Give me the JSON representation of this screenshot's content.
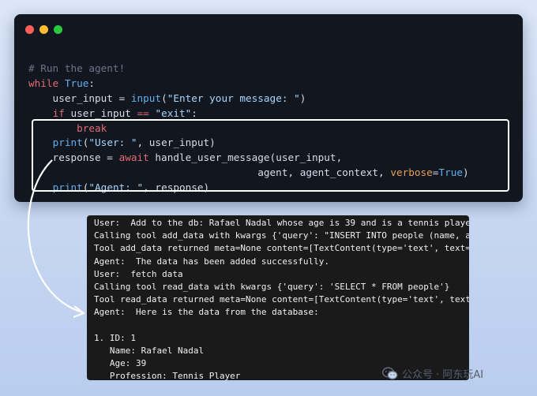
{
  "window_controls": {
    "close_color": "#ff5f57",
    "minimize_color": "#febc2e",
    "maximize_color": "#28c840"
  },
  "syntax_colors": {
    "comment": "#6b7486",
    "keyword": "#e06c75",
    "builtin": "#61afef",
    "string": "#a5d6ff",
    "param": "#e5a25b",
    "text": "#d6dde8"
  },
  "code_lines": [
    [
      {
        "t": "# Run the agent!",
        "c": "comment"
      }
    ],
    [
      {
        "t": "while",
        "c": "keyword"
      },
      {
        "t": " "
      },
      {
        "t": "True",
        "c": "builtin"
      },
      {
        "t": ":"
      }
    ],
    [
      {
        "t": "    user_input = "
      },
      {
        "t": "input",
        "c": "builtin"
      },
      {
        "t": "("
      },
      {
        "t": "\"Enter your message: \"",
        "c": "string"
      },
      {
        "t": ")"
      }
    ],
    [
      {
        "t": "    "
      },
      {
        "t": "if",
        "c": "keyword"
      },
      {
        "t": " user_input "
      },
      {
        "t": "==",
        "c": "keyword"
      },
      {
        "t": " "
      },
      {
        "t": "\"exit\"",
        "c": "string"
      },
      {
        "t": ":"
      }
    ],
    [
      {
        "t": "        "
      },
      {
        "t": "break",
        "c": "keyword"
      }
    ],
    [
      {
        "t": "    "
      },
      {
        "t": "print",
        "c": "builtin"
      },
      {
        "t": "("
      },
      {
        "t": "\"User: \"",
        "c": "string"
      },
      {
        "t": ", user_input)"
      }
    ],
    [
      {
        "t": "    response = "
      },
      {
        "t": "await",
        "c": "keyword"
      },
      {
        "t": " handle_user_message(user_input,"
      }
    ],
    [
      {
        "t": "                                      agent, agent_context, "
      },
      {
        "t": "verbose",
        "c": "param"
      },
      {
        "t": "="
      },
      {
        "t": "True",
        "c": "builtin"
      },
      {
        "t": ")"
      }
    ],
    [
      {
        "t": "    "
      },
      {
        "t": "print",
        "c": "builtin"
      },
      {
        "t": "("
      },
      {
        "t": "\"Agent: \"",
        "c": "string"
      },
      {
        "t": ", response)"
      }
    ]
  ],
  "terminal_lines": [
    "User:  Add to the db: Rafael Nadal whose age is 39 and is a tennis player",
    "Calling tool add_data with kwargs {'query': \"INSERT INTO people (name, age",
    "Tool add_data returned meta=None content=[TextContent(type='text', text='T",
    "Agent:  The data has been added successfully.",
    "User:  fetch data",
    "Calling tool read_data with kwargs {'query': 'SELECT * FROM people'}",
    "Tool read_data returned meta=None content=[TextContent(type='text', text='",
    "Agent:  Here is the data from the database:",
    "",
    "1. ID: 1",
    "   Name: Rafael Nadal",
    "   Age: 39",
    "   Profession: Tennis Player"
  ],
  "watermark": {
    "icon": "wechat-icon",
    "text": "公众号 · 阿东玩AI"
  }
}
